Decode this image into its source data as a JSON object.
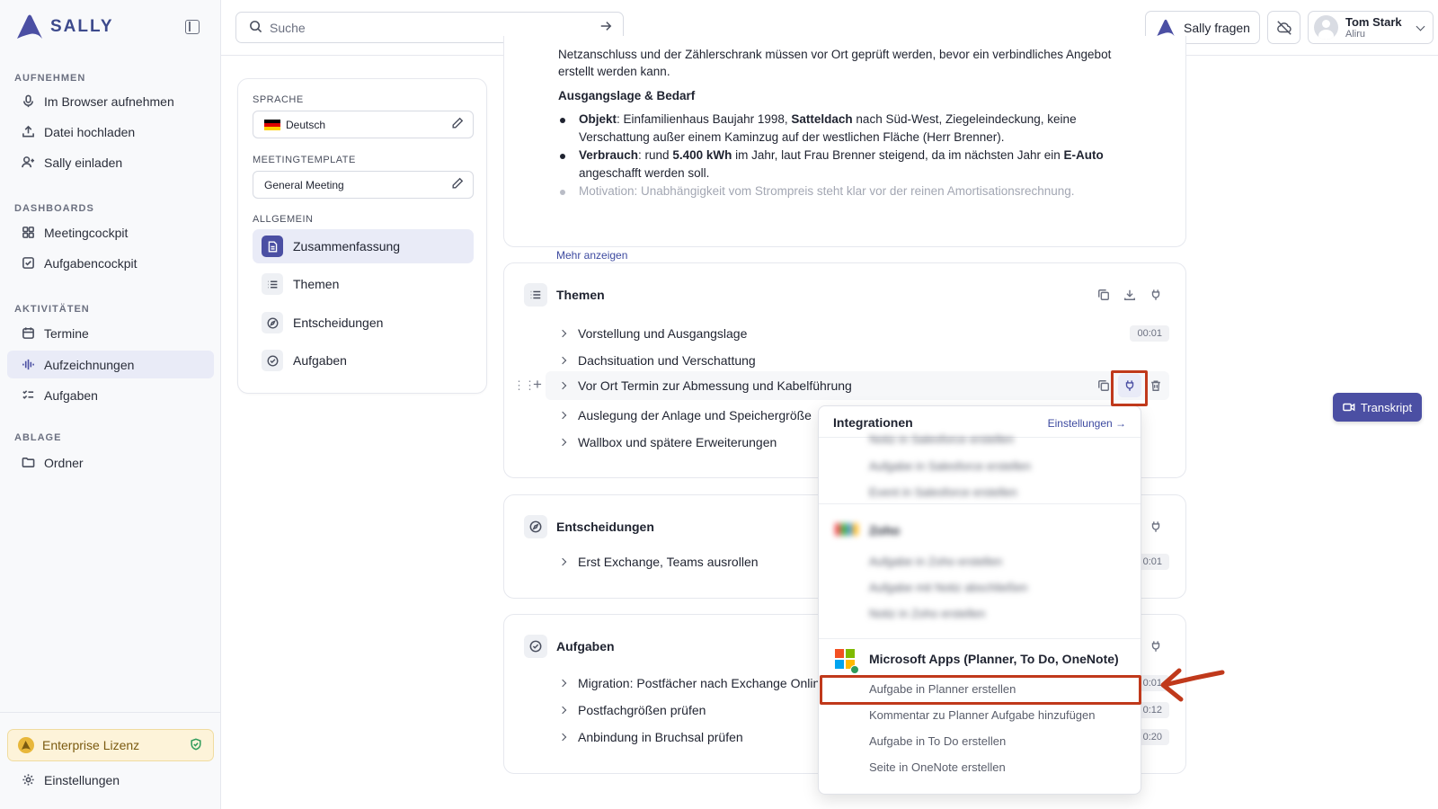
{
  "brand": {
    "name": "SALLY",
    "accent": "#4b4fa3"
  },
  "sidebar": {
    "sections": [
      {
        "title": "AUFNEHMEN",
        "items": [
          {
            "label": "Im Browser aufnehmen",
            "icon": "mic-icon"
          },
          {
            "label": "Datei hochladen",
            "icon": "upload-icon"
          },
          {
            "label": "Sally einladen",
            "icon": "user-plus-icon"
          }
        ]
      },
      {
        "title": "DASHBOARDS",
        "items": [
          {
            "label": "Meetingcockpit",
            "icon": "grid-icon"
          },
          {
            "label": "Aufgabencockpit",
            "icon": "checkbox-icon"
          }
        ]
      },
      {
        "title": "AKTIVITÄTEN",
        "items": [
          {
            "label": "Termine",
            "icon": "calendar-icon"
          },
          {
            "label": "Aufzeichnungen",
            "icon": "waveform-icon",
            "active": true
          },
          {
            "label": "Aufgaben",
            "icon": "list-check-icon"
          }
        ]
      },
      {
        "title": "ABLAGE",
        "items": [
          {
            "label": "Ordner",
            "icon": "folder-icon"
          }
        ]
      }
    ],
    "license": "Enterprise Lizenz",
    "settings": "Einstellungen"
  },
  "topbar": {
    "search_placeholder": "Suche",
    "ask": "Sally fragen",
    "user_name": "Tom Stark",
    "user_org": "Aliru"
  },
  "panel": {
    "language_label": "SPRACHE",
    "language": "Deutsch",
    "template_label": "MEETINGTEMPLATE",
    "template": "General Meeting",
    "general_label": "ALLGEMEIN",
    "nav": [
      "Zusammenfassung",
      "Themen",
      "Entscheidungen",
      "Aufgaben"
    ]
  },
  "summary": {
    "line0a": "Netzanschluss und der Zählerschrank müssen vor Ort geprüft werden, bevor ein verbindliches Angebot",
    "line0b": "erstellt werden kann.",
    "heading": "Ausgangslage & Bedarf",
    "b1_key": "Objekt",
    "b1_a": ": Einfamilienhaus Baujahr 1998, ",
    "b1_bold": "Satteldach",
    "b1_b": " nach Süd-West, Ziegeleindeckung, keine",
    "b1_line2": "Verschattung außer einem Kaminzug auf der westlichen Fläche (Herr Brenner).",
    "b2_key": "Verbrauch",
    "b2_a": ": rund ",
    "b2_bold": "5.400 kWh",
    "b2_b": " im Jahr, laut Frau Brenner steigend, da im nächsten Jahr ein ",
    "b2_bold2": "E-Auto",
    "b2_line2": "angeschafft werden soll.",
    "b3_key": "Motivation",
    "b3_a": ": Unabhängigkeit vom Strompreis steht klar vor der reinen Amortisationsrechnung.",
    "more": "Mehr anzeigen"
  },
  "themen": {
    "title": "Themen",
    "rows": [
      {
        "label": "Vorstellung und Ausgangslage",
        "time": "00:01"
      },
      {
        "label": "Dachsituation und Verschattung"
      },
      {
        "label": "Vor Ort Termin zur Abmessung und Kabelführung"
      },
      {
        "label": "Auslegung der Anlage und Speichergröße"
      },
      {
        "label": "Wallbox und spätere Erweiterungen"
      }
    ]
  },
  "entscheidungen": {
    "title": "Entscheidungen",
    "rows": [
      {
        "label": "Erst Exchange, Teams ausrollen",
        "time": "0:01"
      }
    ]
  },
  "aufgaben": {
    "title": "Aufgaben",
    "rows": [
      {
        "label": "Migration: Postfächer nach Exchange Onlin",
        "time": "0:01"
      },
      {
        "label": "Postfachgrößen prüfen",
        "time": "0:12"
      },
      {
        "label": "Anbindung in Bruchsal prüfen",
        "time": "0:20"
      }
    ]
  },
  "transkript": "Transkript",
  "integrations": {
    "title": "Integrationen",
    "settings": "Einstellungen →",
    "blurred_sf": [
      "Notiz in Salesforce erstellen",
      "Aufgabe in Salesforce erstellen",
      "Event in Salesforce erstellen"
    ],
    "zoho_name": "Zoho",
    "blurred_zoho": [
      "Aufgabe in Zoho erstellen",
      "Aufgabe mit Notiz abschließen",
      "Notiz in Zoho erstellen"
    ],
    "ms_name": "Microsoft Apps (Planner, To Do, OneNote)",
    "ms_items": [
      "Aufgabe in Planner erstellen",
      "Kommentar zu Planner Aufgabe hinzufügen",
      "Aufgabe in To Do erstellen",
      "Seite in OneNote erstellen"
    ]
  },
  "highlight_color": "#c0391b"
}
